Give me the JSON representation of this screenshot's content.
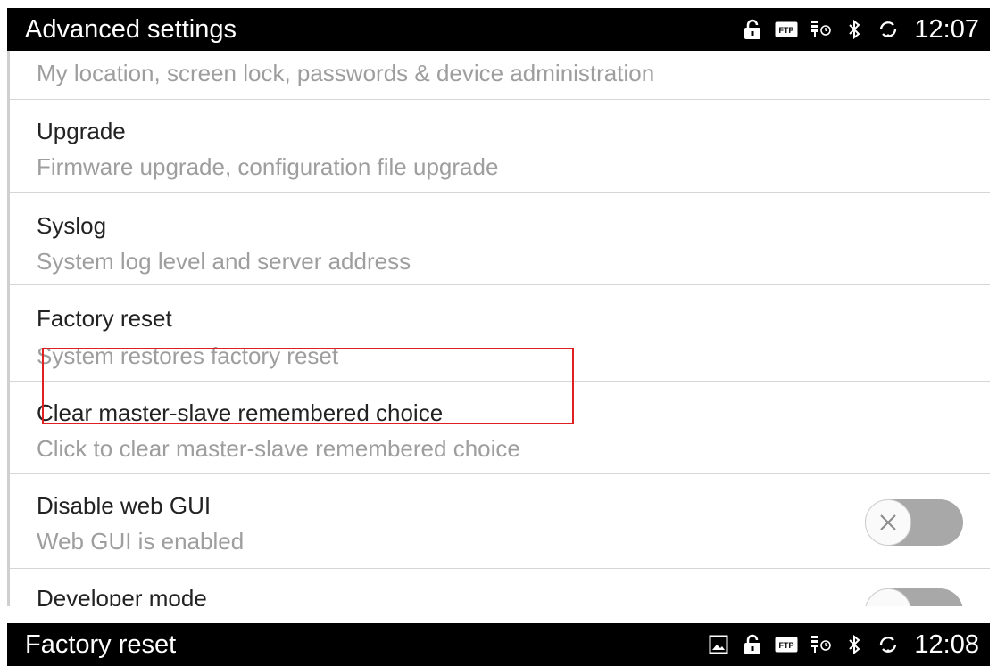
{
  "top_bar": {
    "title": "Advanced settings",
    "time": "12:07",
    "ftp_label": "FTP",
    "icons": [
      "lock-icon",
      "ftp-icon",
      "usb-icon",
      "bluetooth-icon",
      "sync-icon"
    ]
  },
  "settings": {
    "security_subtitle": "My location, screen lock, passwords & device administration",
    "items": [
      {
        "title": "Upgrade",
        "subtitle": "Firmware upgrade, configuration file upgrade"
      },
      {
        "title": "Syslog",
        "subtitle": "System log level and server address"
      },
      {
        "title": "Factory reset",
        "subtitle": "System restores factory reset"
      },
      {
        "title": "Clear master-slave remembered choice",
        "subtitle": "Click to clear master-slave remembered choice"
      },
      {
        "title": "Disable web GUI",
        "subtitle": "Web GUI is enabled",
        "toggle": "off"
      },
      {
        "title": "Developer mode",
        "toggle": "off"
      }
    ]
  },
  "bottom_bar": {
    "title": "Factory reset",
    "time": "12:08",
    "ftp_label": "FTP",
    "icons": [
      "image-icon",
      "lock-icon",
      "ftp-icon",
      "usb-icon",
      "bluetooth-icon",
      "sync-icon"
    ]
  },
  "colors": {
    "status_bar": "#000000",
    "highlight": "#e02020",
    "subtitle": "#9e9e9e",
    "toggle_track": "#a8a8a8"
  }
}
